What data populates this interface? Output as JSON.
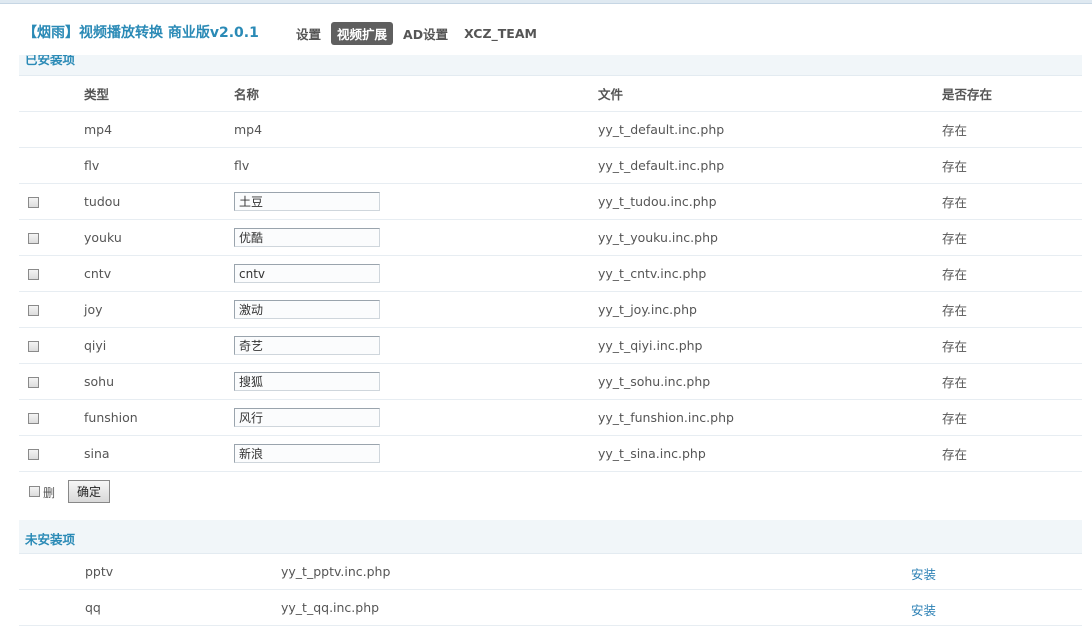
{
  "app": {
    "title": "【烟雨】视频播放转换 商业版v2.0.1"
  },
  "nav": [
    {
      "label": "设置",
      "active": false
    },
    {
      "label": "视频扩展",
      "active": true
    },
    {
      "label": "AD设置",
      "active": false
    },
    {
      "label": "XCZ_TEAM",
      "active": false
    }
  ],
  "installed": {
    "section_label": "已安装项",
    "headers": {
      "type": "类型",
      "name": "名称",
      "file": "文件",
      "exists": "是否存在"
    },
    "rows": [
      {
        "type": "mp4",
        "name": "mp4",
        "file": "yy_t_default.inc.php",
        "exists": "存在",
        "editable": false
      },
      {
        "type": "flv",
        "name": "flv",
        "file": "yy_t_default.inc.php",
        "exists": "存在",
        "editable": false
      },
      {
        "type": "tudou",
        "name": "土豆",
        "file": "yy_t_tudou.inc.php",
        "exists": "存在",
        "editable": true
      },
      {
        "type": "youku",
        "name": "优酷",
        "file": "yy_t_youku.inc.php",
        "exists": "存在",
        "editable": true
      },
      {
        "type": "cntv",
        "name": "cntv",
        "file": "yy_t_cntv.inc.php",
        "exists": "存在",
        "editable": true
      },
      {
        "type": "joy",
        "name": "激动",
        "file": "yy_t_joy.inc.php",
        "exists": "存在",
        "editable": true
      },
      {
        "type": "qiyi",
        "name": "奇艺",
        "file": "yy_t_qiyi.inc.php",
        "exists": "存在",
        "editable": true
      },
      {
        "type": "sohu",
        "name": "搜狐",
        "file": "yy_t_sohu.inc.php",
        "exists": "存在",
        "editable": true
      },
      {
        "type": "funshion",
        "name": "风行",
        "file": "yy_t_funshion.inc.php",
        "exists": "存在",
        "editable": true
      },
      {
        "type": "sina",
        "name": "新浪",
        "file": "yy_t_sina.inc.php",
        "exists": "存在",
        "editable": true
      }
    ],
    "delete_label": "删",
    "confirm_label": "确定"
  },
  "uninstalled": {
    "section_label": "未安装项",
    "rows": [
      {
        "type": "pptv",
        "file": "yy_t_pptv.inc.php",
        "action": "安装"
      },
      {
        "type": "qq",
        "file": "yy_t_qq.inc.php",
        "action": "安装"
      }
    ]
  }
}
